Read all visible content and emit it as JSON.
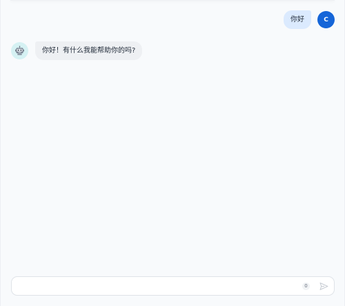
{
  "messages": {
    "user": {
      "avatar_initial": "C",
      "text": "你好"
    },
    "bot": {
      "avatar_icon": "robot-icon",
      "text": "你好！有什么我能帮助你的吗?"
    }
  },
  "input": {
    "value": "",
    "placeholder": "",
    "char_count": "0",
    "send_icon": "send-icon"
  },
  "colors": {
    "background": "#f8fafc",
    "user_bubble": "#dbeafe",
    "user_avatar": "#1565d8",
    "bot_bubble": "#eef0f3",
    "bot_avatar": "#d5f1f3",
    "send_icon": "#c7ccd3"
  }
}
